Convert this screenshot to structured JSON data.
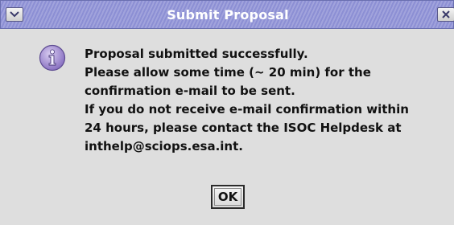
{
  "window": {
    "title": "Submit Proposal",
    "menu_icon": "chevron-down-icon",
    "close_icon": "close-icon"
  },
  "dialog": {
    "icon": "info-icon",
    "message_lines": [
      "Proposal submitted successfully.",
      "Please allow some time (~ 20 min) for the",
      "confirmation e-mail to be sent.",
      "If you do not receive e-mail confirmation within",
      "24 hours, please contact the ISOC Helpdesk at",
      "inthelp@sciops.esa.int."
    ],
    "ok_label": "OK"
  },
  "colors": {
    "titlebar": "#8c8fd4",
    "background": "#dedede",
    "icon_fill": "#a58fd0"
  }
}
